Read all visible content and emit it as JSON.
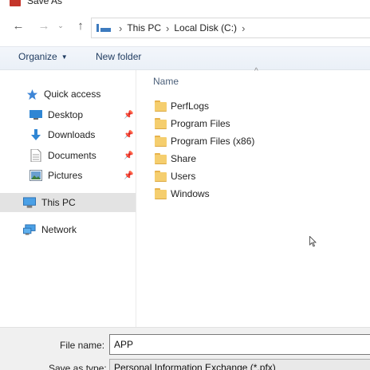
{
  "window": {
    "title": "Save As"
  },
  "navigation": {
    "back": "←",
    "forward": "→",
    "recent": "⌄",
    "up": "↑",
    "breadcrumb": [
      "This PC",
      "Local Disk (C:)"
    ],
    "separator": "›"
  },
  "toolbar": {
    "organize": "Organize",
    "organize_caret": "▼",
    "new_folder": "New folder"
  },
  "nav_pane": {
    "items": [
      {
        "label": "Quick access",
        "icon": "star-icon",
        "pinned": false
      },
      {
        "label": "Desktop",
        "icon": "desktop-icon",
        "pinned": true
      },
      {
        "label": "Downloads",
        "icon": "download-arrow-icon",
        "pinned": true
      },
      {
        "label": "Documents",
        "icon": "document-icon",
        "pinned": true
      },
      {
        "label": "Pictures",
        "icon": "picture-icon",
        "pinned": true
      },
      {
        "label": "This PC",
        "icon": "computer-icon",
        "selected": true
      },
      {
        "label": "Network",
        "icon": "network-icon"
      }
    ],
    "pin_glyph": "📌"
  },
  "content": {
    "column_header": "Name",
    "sort_indicator": "^",
    "folders": [
      "PerfLogs",
      "Program Files",
      "Program Files (x86)",
      "Share",
      "Users",
      "Windows"
    ]
  },
  "footer": {
    "file_name_label": "File name:",
    "file_name_value": "APP",
    "save_as_type_label": "Save as type:",
    "save_as_type_value": "Personal Information Exchange (*.pfx)"
  },
  "colors": {
    "accent": "#3d7bbf",
    "folder": "#f5ce6e",
    "selection": "#e3e3e3"
  }
}
